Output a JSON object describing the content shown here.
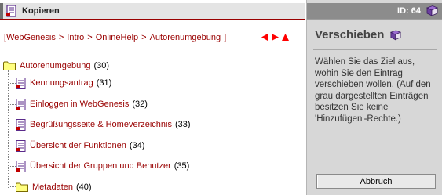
{
  "header": {
    "title": "Kopieren",
    "id_label": "ID: 64"
  },
  "breadcrumb": {
    "open": "[",
    "close": "]",
    "separator": ">",
    "items": [
      "WebGenesis",
      "Intro",
      "OnlineHelp",
      "Autorenumgebung"
    ]
  },
  "nav": {
    "prev_icon": "left-arrow-icon",
    "next_icon": "right-arrow-icon",
    "up_icon": "up-arrow-icon",
    "color": "#ff0000"
  },
  "tree": {
    "root": {
      "label": "Autorenumgebung",
      "count": "(30)",
      "icon": "folder-icon"
    },
    "children": [
      {
        "label": "Kennungsantrag",
        "count": "(31)",
        "icon": "document-icon"
      },
      {
        "label": "Einloggen in WebGenesis",
        "count": "(32)",
        "icon": "document-icon"
      },
      {
        "label": "Begrüßungsseite & Homeverzeichnis",
        "count": "(33)",
        "icon": "document-icon"
      },
      {
        "label": "Übersicht der Funktionen",
        "count": "(34)",
        "icon": "document-icon"
      },
      {
        "label": "Übersicht der Gruppen und Benutzer",
        "count": "(35)",
        "icon": "document-icon"
      },
      {
        "label": "Metadaten",
        "count": "(40)",
        "icon": "folder-icon"
      }
    ]
  },
  "panel": {
    "heading": "Verschieben",
    "description": "Wählen Sie das Ziel aus, wohin Sie den Eintrag verschieben wollen. (Auf den grau dargestellten Einträgen besitzen Sie keine 'Hinzufügen'-Rechte.)",
    "cancel_label": "Abbruch"
  },
  "colors": {
    "link": "#990000",
    "accent_line": "#990000",
    "panel_bg": "#d7d7d7",
    "book": "#6b3fa0"
  }
}
